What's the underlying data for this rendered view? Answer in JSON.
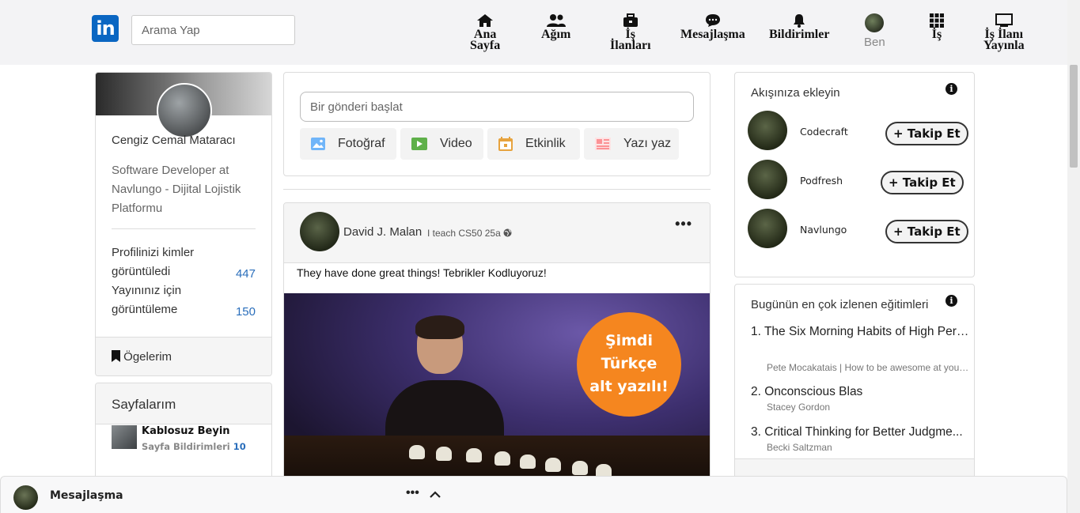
{
  "header": {
    "logo_text": "in",
    "search_placeholder": "Arama Yap",
    "nav": [
      {
        "line1": "Ana",
        "line2": "Sayfa",
        "icon": "home-icon"
      },
      {
        "line1": "Ağım",
        "line2": "",
        "icon": "users-icon"
      },
      {
        "line1": "İş",
        "line2": "İlanları",
        "icon": "briefcase-icon"
      },
      {
        "line1": "Mesajlaşma",
        "line2": "",
        "icon": "chat-icon"
      },
      {
        "line1": "Bildirimler",
        "line2": "",
        "icon": "bell-icon"
      },
      {
        "line1": "Ben",
        "line2": "",
        "icon": "avatar"
      },
      {
        "line1": "İş",
        "line2": "",
        "icon": "grid-icon"
      },
      {
        "line1": "İş İlanı",
        "line2": "Yayınla",
        "icon": "monitor-icon"
      }
    ]
  },
  "profile": {
    "name": "Cengiz Cemal Mataracı",
    "title": "Software Developer at Navlungo - Dijital Lojistik Platformu",
    "stats": [
      {
        "label": "Profilinizi kimler görüntüledi",
        "value": "447"
      },
      {
        "label": "Yayınınız için görüntüleme",
        "value": "150"
      }
    ],
    "items_label": "Ögelerim"
  },
  "pages": {
    "title": "Sayfalarım",
    "page_name": "Kablosuz Beyin",
    "notif_label": "Sayfa Bildirimleri",
    "notif_count": "10"
  },
  "share": {
    "placeholder": "Bir gönderi başlat",
    "buttons": [
      {
        "label": "Fotoğraf",
        "icon": "photo-icon",
        "color": "#70b5f9"
      },
      {
        "label": "Video",
        "icon": "video-icon",
        "color": "#5fb04a"
      },
      {
        "label": "Etkinlik",
        "icon": "calendar-icon",
        "color": "#e7a33e"
      },
      {
        "label": "Yazı yaz",
        "icon": "article-icon",
        "color": "#fc9295"
      }
    ]
  },
  "post": {
    "author": "David J. Malan",
    "subtitle": "I teach CS50",
    "time": "25a",
    "menu": "•••",
    "text": "They have done great things! Tebrikler Kodluyoruz!",
    "image_badge": [
      "Şimdi",
      "Türkçe",
      "alt yazılı!"
    ]
  },
  "follow": {
    "title": "Akışınıza ekleyin",
    "button_label": "+ Takip Et",
    "suggestions": [
      {
        "name": "Codecraft"
      },
      {
        "name": "Podfresh"
      },
      {
        "name": "Navlungo"
      }
    ]
  },
  "courses": {
    "title": "Bugünün en çok izlenen eğitimleri",
    "items": [
      {
        "num": "1.",
        "title": "The Six Morning Habits of High Perf...",
        "author": "Pete Mocakatais | How to be awesome at your..."
      },
      {
        "num": "2.",
        "title": "Onconscious Blas",
        "author": "Stacey Gordon"
      },
      {
        "num": "3.",
        "title": "Critical Thinking for Better Judgme...",
        "author": "Becki Saltzman"
      }
    ]
  },
  "messaging": {
    "title": "Mesajlaşma",
    "dots": "•••"
  }
}
